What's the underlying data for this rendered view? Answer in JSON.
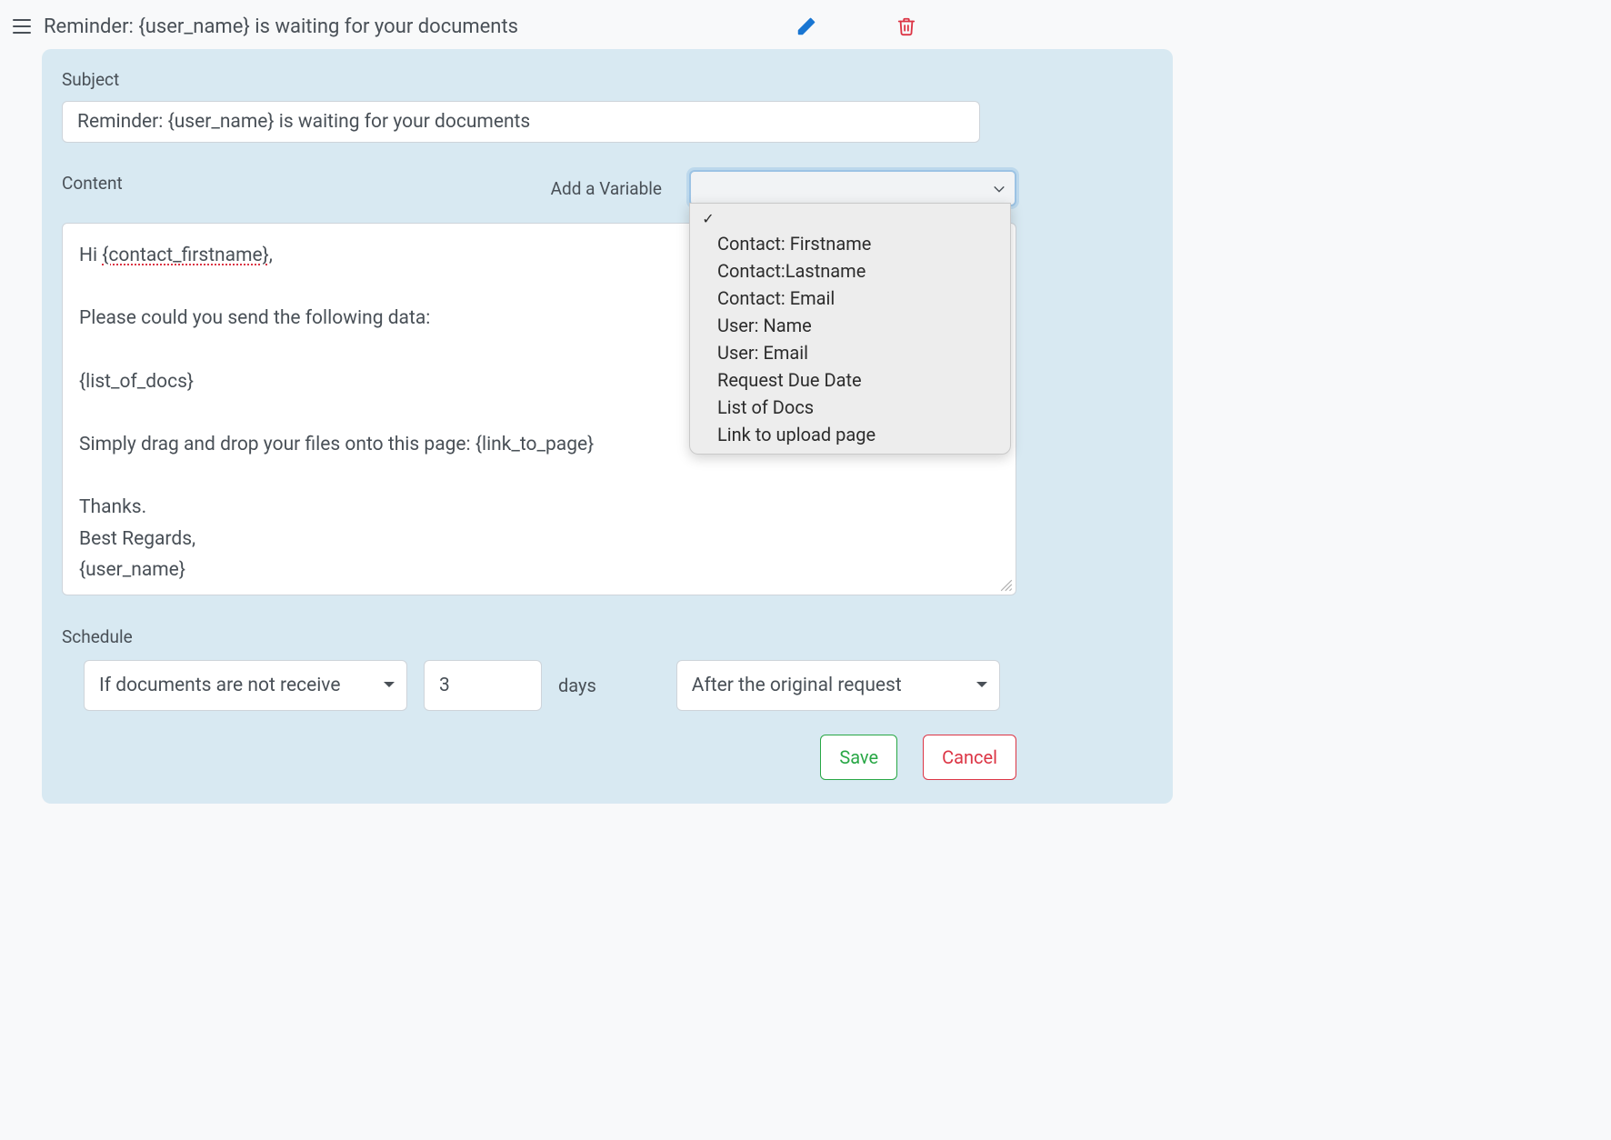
{
  "header": {
    "title": "Reminder: {user_name} is waiting for your documents"
  },
  "labels": {
    "subject": "Subject",
    "content": "Content",
    "add_variable": "Add a Variable",
    "schedule": "Schedule",
    "days": "days"
  },
  "subject_value": "Reminder: {user_name} is waiting for your documents",
  "variable_dropdown": {
    "selected": "",
    "options": [
      "Contact: Firstname",
      "Contact:Lastname",
      "Contact: Email",
      "User: Name",
      "User: Email",
      "Request Due Date",
      "List of Docs",
      "Link to upload page"
    ]
  },
  "content_body": {
    "line1_prefix": "Hi ",
    "line1_var": "{contact_firstname}",
    "line1_suffix": ",",
    "line2": "Please could you send the following data:",
    "line3": "{list_of_docs}",
    "line4": "Simply drag and drop your files onto this page: {link_to_page}",
    "line5": "Thanks.",
    "line6": "Best Regards,",
    "line7": "{user_name}"
  },
  "schedule": {
    "condition_value": "If documents are not receive",
    "days_value": "3",
    "timing_value": "After the original request"
  },
  "buttons": {
    "save": "Save",
    "cancel": "Cancel"
  }
}
